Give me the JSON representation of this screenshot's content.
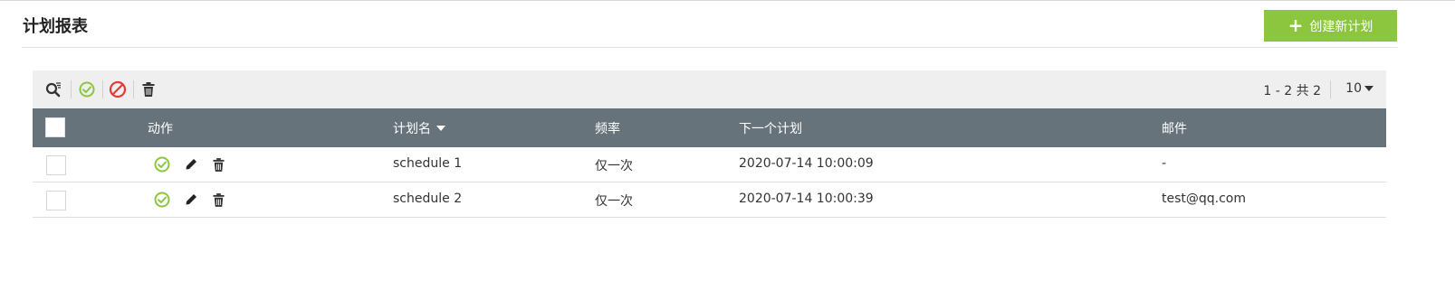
{
  "page": {
    "title": "计划报表"
  },
  "actions": {
    "create_label": "创建新计划"
  },
  "toolbar": {
    "icons": [
      "search-filter-icon",
      "enable-icon",
      "disable-icon",
      "delete-icon"
    ],
    "pager_text": "1 - 2 共 2",
    "page_size": "10"
  },
  "table": {
    "columns": [
      "动作",
      "计划名",
      "频率",
      "下一个计划",
      "邮件"
    ],
    "sorted_column": "计划名",
    "rows": [
      {
        "name": "schedule 1",
        "frequency": "仅一次",
        "next_run": "2020-07-14 10:00:09",
        "email": "-"
      },
      {
        "name": "schedule 2",
        "frequency": "仅一次",
        "next_run": "2020-07-14 10:00:39",
        "email": "test@qq.com"
      }
    ]
  },
  "colors": {
    "accent": "#8cc63f",
    "header_bg": "#67737b",
    "toolbar_bg": "#efefef",
    "enable": "#8cc63f",
    "disable": "#e53935"
  }
}
